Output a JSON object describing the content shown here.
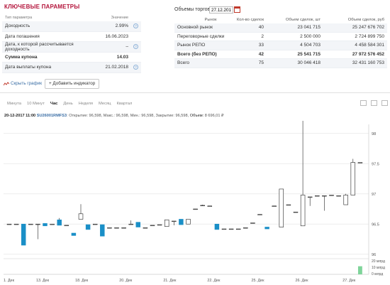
{
  "key_params": {
    "title": "КЛЮЧЕВЫЕ ПАРАМЕТРЫ",
    "col_name": "Тип параметра",
    "col_value": "Значение",
    "rows": [
      {
        "name": "Доходность",
        "value": "2.99%",
        "help": true,
        "bold": false
      },
      {
        "name": "Дата погашения",
        "value": "16.06.2023",
        "help": false,
        "bold": false
      },
      {
        "name": "Дата, к которой рассчитывается доходность",
        "value": "–",
        "help": true,
        "bold": false
      },
      {
        "name": "Сумма купона",
        "value": "14.03",
        "help": false,
        "bold": true
      },
      {
        "name": "Дата выплаты купона",
        "value": "21.02.2018",
        "help": true,
        "bold": false
      }
    ]
  },
  "volumes": {
    "title": "Объемы торгов",
    "date": "27.12.2017",
    "headers": [
      "Рынок",
      "Кол-во сделок",
      "Объем сделок, шт",
      "Объем сделок, руб"
    ],
    "rows": [
      {
        "market": "Основной рынок",
        "deals": "40",
        "qty": "23 041 715",
        "rub": "25 247 676 702",
        "bold": false
      },
      {
        "market": "Переговорные сделки",
        "deals": "2",
        "qty": "2 500 000",
        "rub": "2 724 899 750",
        "bold": false
      },
      {
        "market": "Рынок РЕПО",
        "deals": "33",
        "qty": "4 504 703",
        "rub": "4 458 584 301",
        "bold": false
      },
      {
        "market": "Всего (без РЕПО)",
        "deals": "42",
        "qty": "25 541 715",
        "rub": "27 972 576 452",
        "bold": true
      },
      {
        "market": "Всего",
        "deals": "75",
        "qty": "30 046 418",
        "rub": "32 431 160 753",
        "bold": false
      }
    ]
  },
  "toolbar": {
    "hide_chart": "Скрыть график",
    "add_indicator": "+ Добавить индикатор",
    "timeframes": [
      "Минута",
      "10 Минут",
      "Час",
      "День",
      "Неделя",
      "Месяц",
      "Квартал"
    ],
    "active_timeframe": "Час"
  },
  "chart_info": {
    "date": "20-12-2017 11:00",
    "ticker": "SU26001RMFS3",
    "ohlc": ": Открытие: 96,598, Макс.: 96,598, Мин.: 96,598, Закрытие: 96,598,",
    "volume_label": "Объем:",
    "volume_value": "8 696,01 ₽"
  },
  "colors": {
    "title_red": "#b3133a",
    "link_blue": "#3a6ea5",
    "candle_down": "#1a8fc7",
    "volume_green": "#7fd49a"
  },
  "chart_data": {
    "type": "candlestick",
    "y_ticks": [
      "98",
      "97.5",
      "97",
      "96.5",
      "96"
    ],
    "ylim": [
      95.95,
      98.15
    ],
    "x_tick_labels": [
      "1. Дек",
      "13. Дек",
      "18. Дек",
      "20. Дек",
      "21. Дек",
      "22. Дек",
      "25. Дек",
      "26. Дек",
      "27. Дек"
    ],
    "volume_ticks": [
      "20 млрд",
      "10 млрд",
      "0 млрд"
    ],
    "candles": [
      {
        "o": 96.5,
        "c": 96.5,
        "h": 96.5,
        "l": 96.5
      },
      {
        "o": 96.5,
        "c": 96.5,
        "h": 96.5,
        "l": 96.5
      },
      {
        "o": 96.5,
        "c": 96.15,
        "h": 96.5,
        "l": 96.15
      },
      {
        "o": 96.5,
        "c": 96.5,
        "h": 96.5,
        "l": 96.5
      },
      {
        "o": 96.5,
        "c": 96.5,
        "h": 96.5,
        "l": 96.25
      },
      {
        "o": 96.51,
        "c": 96.47,
        "h": 96.51,
        "l": 96.47
      },
      {
        "o": 96.49,
        "c": 96.5,
        "h": 96.5,
        "l": 96.49
      },
      {
        "o": 96.57,
        "c": 96.48,
        "h": 96.6,
        "l": 96.48
      },
      {
        "o": 96.48,
        "c": 96.48,
        "h": 96.48,
        "l": 96.48
      },
      {
        "o": 96.35,
        "c": 96.31,
        "h": 96.35,
        "l": 96.31
      },
      {
        "o": 96.58,
        "c": 96.67,
        "h": 96.83,
        "l": 96.58
      },
      {
        "o": 96.49,
        "c": 96.41,
        "h": 96.49,
        "l": 96.41
      },
      {
        "o": 96.5,
        "c": 96.5,
        "h": 96.5,
        "l": 96.5
      },
      {
        "o": 96.49,
        "c": 96.3,
        "h": 96.49,
        "l": 96.3
      },
      {
        "o": 96.44,
        "c": 96.44,
        "h": 96.44,
        "l": 96.44
      },
      {
        "o": 96.44,
        "c": 96.44,
        "h": 96.44,
        "l": 96.44
      },
      {
        "o": 96.44,
        "c": 96.44,
        "h": 96.44,
        "l": 96.44
      },
      {
        "o": 96.5,
        "c": 96.5,
        "h": 96.56,
        "l": 96.5
      },
      {
        "o": 96.53,
        "c": 96.45,
        "h": 96.53,
        "l": 96.45
      },
      {
        "o": 96.44,
        "c": 96.44,
        "h": 96.44,
        "l": 96.44
      },
      {
        "o": 96.48,
        "c": 96.48,
        "h": 96.48,
        "l": 96.48
      },
      {
        "o": 96.49,
        "c": 96.49,
        "h": 96.49,
        "l": 96.49
      },
      {
        "o": 96.46,
        "c": 96.57,
        "h": 96.57,
        "l": 96.46
      },
      {
        "o": 96.55,
        "c": 96.55,
        "h": 96.55,
        "l": 96.48
      },
      {
        "o": 96.58,
        "c": 96.49,
        "h": 96.58,
        "l": 96.49
      },
      {
        "o": 96.5,
        "c": 96.58,
        "h": 96.58,
        "l": 96.5
      },
      {
        "o": 96.75,
        "c": 96.75,
        "h": 96.75,
        "l": 96.75
      },
      {
        "o": 96.81,
        "c": 96.81,
        "h": 96.82,
        "l": 96.81
      },
      {
        "o": 96.8,
        "c": 96.8,
        "h": 96.8,
        "l": 96.8
      },
      {
        "o": 96.5,
        "c": 96.41,
        "h": 96.5,
        "l": 96.41
      },
      {
        "o": 96.42,
        "c": 96.42,
        "h": 96.42,
        "l": 96.42
      },
      {
        "o": 96.42,
        "c": 96.42,
        "h": 96.42,
        "l": 96.42
      },
      {
        "o": 96.42,
        "c": 96.42,
        "h": 96.42,
        "l": 96.42
      },
      {
        "o": 96.44,
        "c": 96.44,
        "h": 96.44,
        "l": 96.44
      },
      {
        "o": 96.52,
        "c": 96.52,
        "h": 96.52,
        "l": 96.52
      },
      {
        "o": 96.66,
        "c": 96.66,
        "h": 96.66,
        "l": 96.66
      },
      {
        "o": 96.45,
        "c": 96.42,
        "h": 96.45,
        "l": 96.42
      },
      {
        "o": 96.8,
        "c": 96.8,
        "h": 96.8,
        "l": 96.8
      },
      {
        "o": 96.45,
        "c": 97.08,
        "h": 97.08,
        "l": 96.45
      },
      {
        "o": 96.82,
        "c": 96.82,
        "h": 96.82,
        "l": 96.82
      },
      {
        "o": 96.7,
        "c": 96.7,
        "h": 96.7,
        "l": 96.7
      },
      {
        "o": 96.47,
        "c": 96.98,
        "h": 98.65,
        "l": 96.47
      },
      {
        "o": 96.95,
        "c": 96.95,
        "h": 96.95,
        "l": 96.8
      },
      {
        "o": 96.97,
        "c": 96.97,
        "h": 96.97,
        "l": 96.97
      },
      {
        "o": 96.97,
        "c": 96.97,
        "h": 96.97,
        "l": 96.72
      },
      {
        "o": 96.98,
        "c": 96.98,
        "h": 96.98,
        "l": 96.98
      },
      {
        "o": 96.97,
        "c": 96.97,
        "h": 96.97,
        "l": 96.97
      },
      {
        "o": 96.82,
        "c": 96.98,
        "h": 97.0,
        "l": 96.82
      },
      {
        "o": 96.98,
        "c": 97.52,
        "h": 97.58,
        "l": 96.98
      },
      {
        "o": 97.52,
        "c": 97.52,
        "h": 97.52,
        "l": 97.52
      }
    ],
    "volume": [
      0,
      0,
      0,
      0,
      0,
      0,
      0,
      0,
      0,
      0,
      0,
      0,
      0,
      0,
      0,
      0,
      0,
      0,
      0,
      0,
      0,
      0,
      0,
      0,
      0,
      0,
      0,
      0,
      0,
      0,
      0,
      0,
      0,
      0,
      0,
      0,
      0,
      0,
      0,
      0,
      0,
      0,
      0,
      0,
      0,
      0,
      0,
      0,
      0,
      12
    ]
  }
}
